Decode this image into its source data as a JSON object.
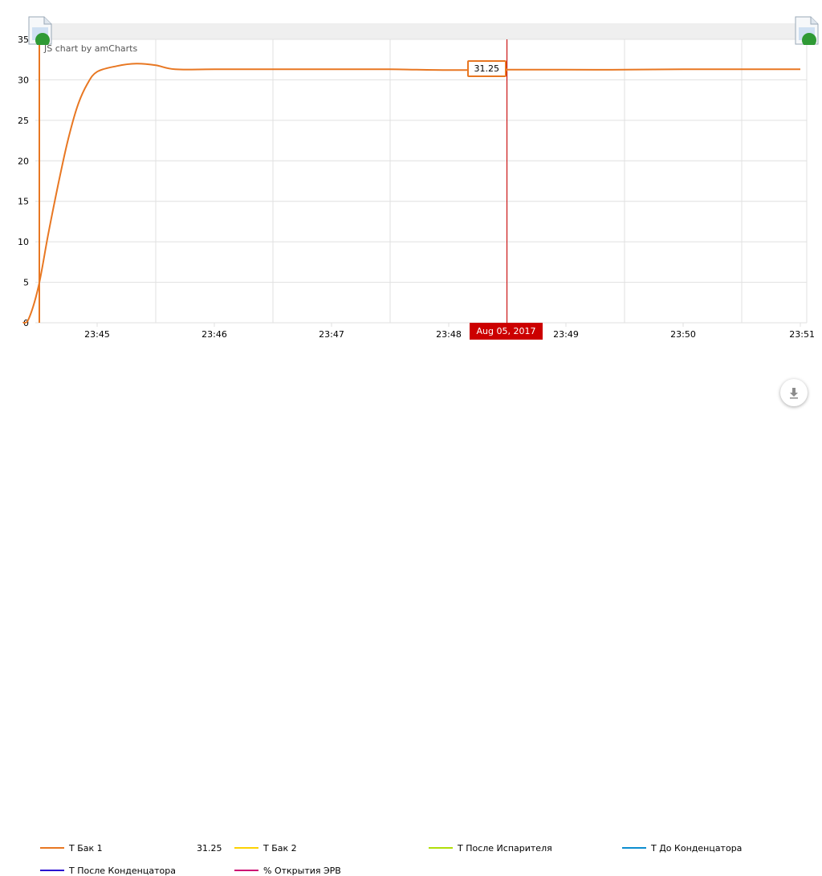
{
  "watermark": "JS chart by amCharts",
  "colors": {
    "grid": "#e0e0e0",
    "axis": "#e87722",
    "cursor": "#cc0000",
    "scrollbar": "#efefef"
  },
  "chart_data": {
    "type": "line",
    "xlabel": "",
    "ylabel": "",
    "ylim": [
      0,
      35
    ],
    "y_ticks": [
      0,
      5,
      10,
      15,
      20,
      25,
      30,
      35
    ],
    "x_tick_labels": [
      "23:45",
      "23:46",
      "23:47",
      "23:48",
      "23:49",
      "23:50",
      "23:51"
    ],
    "grid": true,
    "legend_position": "bottom",
    "series": [
      {
        "name": "Т Бак 1",
        "color": "#e87722",
        "x": [
          "23:44:22",
          "23:44:25",
          "23:44:30",
          "23:44:35",
          "23:44:40",
          "23:44:45",
          "23:44:50",
          "23:44:55",
          "23:45:00",
          "23:45:10",
          "23:45:20",
          "23:45:30",
          "23:45:40",
          "23:46:00",
          "23:46:30",
          "23:47:00",
          "23:47:30",
          "23:48:00",
          "23:48:30",
          "23:49:00",
          "23:49:30",
          "23:50:00",
          "23:50:30",
          "23:51:00"
        ],
        "y": [
          0.0,
          0.5,
          4.5,
          11.0,
          17.0,
          22.5,
          26.8,
          29.5,
          31.0,
          31.7,
          32.0,
          31.8,
          31.3,
          31.3,
          31.3,
          31.3,
          31.3,
          31.2,
          31.25,
          31.25,
          31.25,
          31.3,
          31.3,
          31.3
        ]
      },
      {
        "name": "Т Бак 2",
        "color": "#fcd202",
        "x": [],
        "y": []
      },
      {
        "name": "Т После Испарителя",
        "color": "#b0de09",
        "x": [],
        "y": []
      },
      {
        "name": "Т До Конденцатора",
        "color": "#0d8ecf",
        "x": [],
        "y": []
      },
      {
        "name": "Т После Конденцатора",
        "color": "#2a0cd0",
        "x": [],
        "y": []
      },
      {
        "name": "% Открытия ЭРВ",
        "color": "#cd0d74",
        "x": [],
        "y": []
      }
    ],
    "cursor": {
      "date_label": "Aug 05, 2017",
      "value_label": "31.25",
      "x": "23:48:30",
      "y": 31.25
    },
    "legend_value": "31.25"
  }
}
